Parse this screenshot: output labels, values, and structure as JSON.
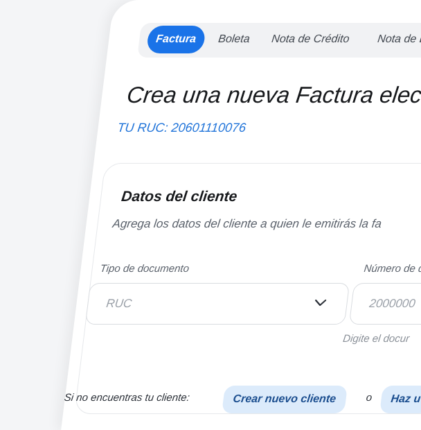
{
  "tabs": [
    "Factura",
    "Boleta",
    "Nota de Crédito",
    "Nota de Débito"
  ],
  "active_tab": "Factura",
  "page_title": "Crea una nueva Factura electr",
  "ruc_label": "TU RUC: 20601110076",
  "client_section": {
    "title": "Datos del cliente",
    "subtitle": "Agrega los datos del cliente a quien le emitirás la fa"
  },
  "document_type": {
    "label": "Tipo de documento",
    "value": "RUC"
  },
  "document_number": {
    "label": "Número de d",
    "placeholder": "2000000",
    "helper": "Digite el docur"
  },
  "footer": {
    "prompt": "Si no encuentras tu cliente:",
    "create_label": "Crear nuevo cliente",
    "or_label": "o",
    "second_label": "Haz u"
  },
  "colors": {
    "accent": "#1a73e8",
    "pill_bg": "#dcebfb"
  }
}
